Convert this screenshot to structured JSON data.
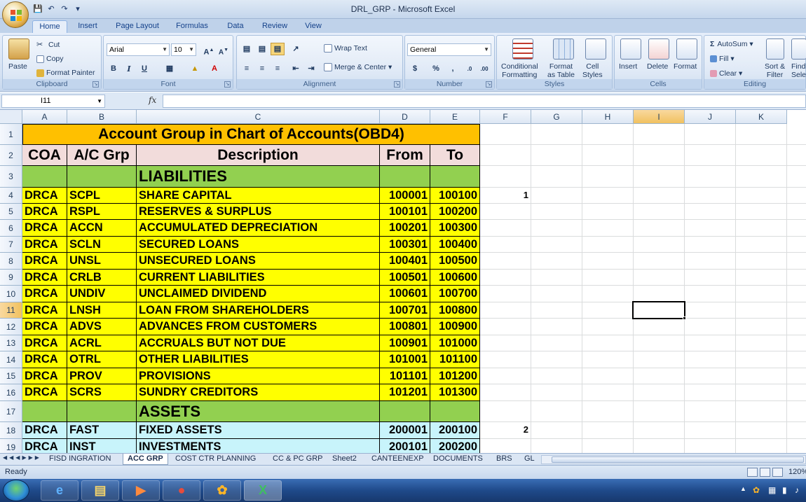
{
  "window": {
    "title": "DRL_GRP - Microsoft Excel"
  },
  "ribbon_tabs": [
    "Home",
    "Insert",
    "Page Layout",
    "Formulas",
    "Data",
    "Review",
    "View"
  ],
  "clipboard": {
    "paste": "Paste",
    "cut": "Cut",
    "copy": "Copy",
    "format_painter": "Format Painter",
    "label": "Clipboard"
  },
  "font": {
    "name": "Arial",
    "size": "10",
    "label": "Font",
    "bold": "B",
    "italic": "I",
    "underline": "U"
  },
  "alignment": {
    "wrap_text": "Wrap Text",
    "merge_center": "Merge & Center",
    "label": "Alignment"
  },
  "number": {
    "format": "General",
    "currency": "$",
    "percent": "%",
    "comma": ",",
    "label": "Number"
  },
  "styles": {
    "conditional": "Conditional",
    "conditional2": "Formatting",
    "format_table": "Format",
    "format_table2": "as Table",
    "cell_styles": "Cell",
    "cell_styles2": "Styles",
    "label": "Styles"
  },
  "cells": {
    "insert": "Insert",
    "delete": "Delete",
    "format": "Format",
    "label": "Cells"
  },
  "editing": {
    "autosum": "AutoSum",
    "fill": "Fill",
    "clear": "Clear",
    "sort": "Sort &",
    "sort2": "Filter",
    "find": "Find",
    "find2": "Sele",
    "label": "Editing"
  },
  "formula_bar": {
    "name_box": "I11",
    "fx": "fx",
    "formula": ""
  },
  "columns": [
    "A",
    "B",
    "C",
    "D",
    "E",
    "F",
    "G",
    "H",
    "I",
    "J",
    "K"
  ],
  "rows": [
    "1",
    "2",
    "3",
    "4",
    "5",
    "6",
    "7",
    "8",
    "9",
    "10",
    "11",
    "12",
    "13",
    "14",
    "15",
    "16",
    "17",
    "18",
    "19"
  ],
  "sheet": {
    "title": "Account Group in Chart of Accounts(OBD4)",
    "headers": [
      "COA",
      "A/C Grp",
      "Description",
      "From",
      "To"
    ],
    "section_liabilities": "LIABILITIES",
    "section_assets": "ASSETS",
    "liabilities": [
      [
        "DRCA",
        "SCPL",
        "SHARE CAPITAL",
        "100001",
        "100100"
      ],
      [
        "DRCA",
        "RSPL",
        "RESERVES & SURPLUS",
        "100101",
        "100200"
      ],
      [
        "DRCA",
        "ACCN",
        "ACCUMULATED DEPRECIATION",
        "100201",
        "100300"
      ],
      [
        "DRCA",
        "SCLN",
        "SECURED LOANS",
        "100301",
        "100400"
      ],
      [
        "DRCA",
        "UNSL",
        "UNSECURED LOANS",
        "100401",
        "100500"
      ],
      [
        "DRCA",
        "CRLB",
        "CURRENT LIABILITIES",
        "100501",
        "100600"
      ],
      [
        "DRCA",
        "UNDIV",
        "UNCLAIMED DIVIDEND",
        "100601",
        "100700"
      ],
      [
        "DRCA",
        "LNSH",
        "LOAN FROM SHAREHOLDERS",
        "100701",
        "100800"
      ],
      [
        "DRCA",
        "ADVS",
        "ADVANCES FROM CUSTOMERS",
        "100801",
        "100900"
      ],
      [
        "DRCA",
        "ACRL",
        "ACCRUALS BUT NOT DUE",
        "100901",
        "101000"
      ],
      [
        "DRCA",
        "OTRL",
        "OTHER LIABILITIES",
        "101001",
        "101100"
      ],
      [
        "DRCA",
        "PROV",
        "PROVISIONS",
        "101101",
        "101200"
      ],
      [
        "DRCA",
        "SCRS",
        "SUNDRY CREDITORS",
        "101201",
        "101300"
      ]
    ],
    "assets": [
      [
        "DRCA",
        "FAST",
        "FIXED ASSETS",
        "200001",
        "200100"
      ],
      [
        "DRCA",
        "INST",
        "INVESTMENTS",
        "200101",
        "200200"
      ]
    ],
    "f4": "1",
    "f18": "2"
  },
  "sheet_tabs": [
    "FISD INGRATION",
    "ACC GRP",
    "COST CTR PLANNING",
    "CC & PC GRP",
    "Sheet2",
    "CANTEENEXP",
    "DOCUMENTS",
    "BRS",
    "GL"
  ],
  "active_sheet": "ACC GRP",
  "status": {
    "text": "Ready",
    "zoom": "120%"
  }
}
